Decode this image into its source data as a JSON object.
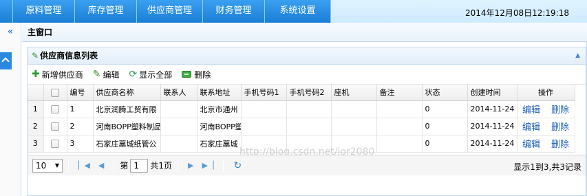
{
  "topnav": {
    "menu": [
      "",
      "原料管理",
      "库存管理",
      "供应商管理",
      "财务管理",
      "系统设置"
    ],
    "clock": "2014年12月08日12:19:18"
  },
  "sidebar": {
    "collapse_icon": "«"
  },
  "main_window": {
    "title": "主窗口"
  },
  "panel": {
    "title": "供应商信息列表"
  },
  "toolbar": {
    "add_label": "新增供应商",
    "edit_label": "编辑",
    "show_all_label": "显示全部",
    "delete_label": "删除"
  },
  "grid": {
    "columns": [
      "编号",
      "供应商名称",
      "联系人",
      "联系地址",
      "手机号码1",
      "手机号码2",
      "座机",
      "备注",
      "状态",
      "创建时间",
      "操作"
    ],
    "rows": [
      {
        "rownum": "1",
        "id": "1",
        "name": "北京润腾工贸有限",
        "contact": "",
        "address": "北京市通州",
        "phone1": "",
        "phone2": "",
        "landline": "",
        "remark": "",
        "status": "0",
        "created": "2014-11-24",
        "edit": "编辑",
        "delete": "删除"
      },
      {
        "rownum": "2",
        "id": "2",
        "name": "河南BOPP塑料制品",
        "contact": "",
        "address": "河南BOPP塑",
        "phone1": "",
        "phone2": "",
        "landline": "",
        "remark": "",
        "status": "0",
        "created": "2014-11-24",
        "edit": "编辑",
        "delete": "删除"
      },
      {
        "rownum": "3",
        "id": "3",
        "name": "石家庄藁城纸管公",
        "contact": "",
        "address": "石家庄藁城",
        "phone1": "",
        "phone2": "",
        "landline": "",
        "remark": "",
        "status": "0",
        "created": "2014-11-24",
        "edit": "编辑",
        "delete": "删除"
      }
    ]
  },
  "pager": {
    "page_size": "10",
    "page_prefix": "第",
    "page_value": "1",
    "page_suffix": "共1页",
    "info": "显示1到3,共3记录"
  },
  "watermark": "http://blog.csdn.net/jor2080",
  "colors": {
    "nav_blue": "#1a7fd6",
    "link": "#1e5fb4"
  }
}
